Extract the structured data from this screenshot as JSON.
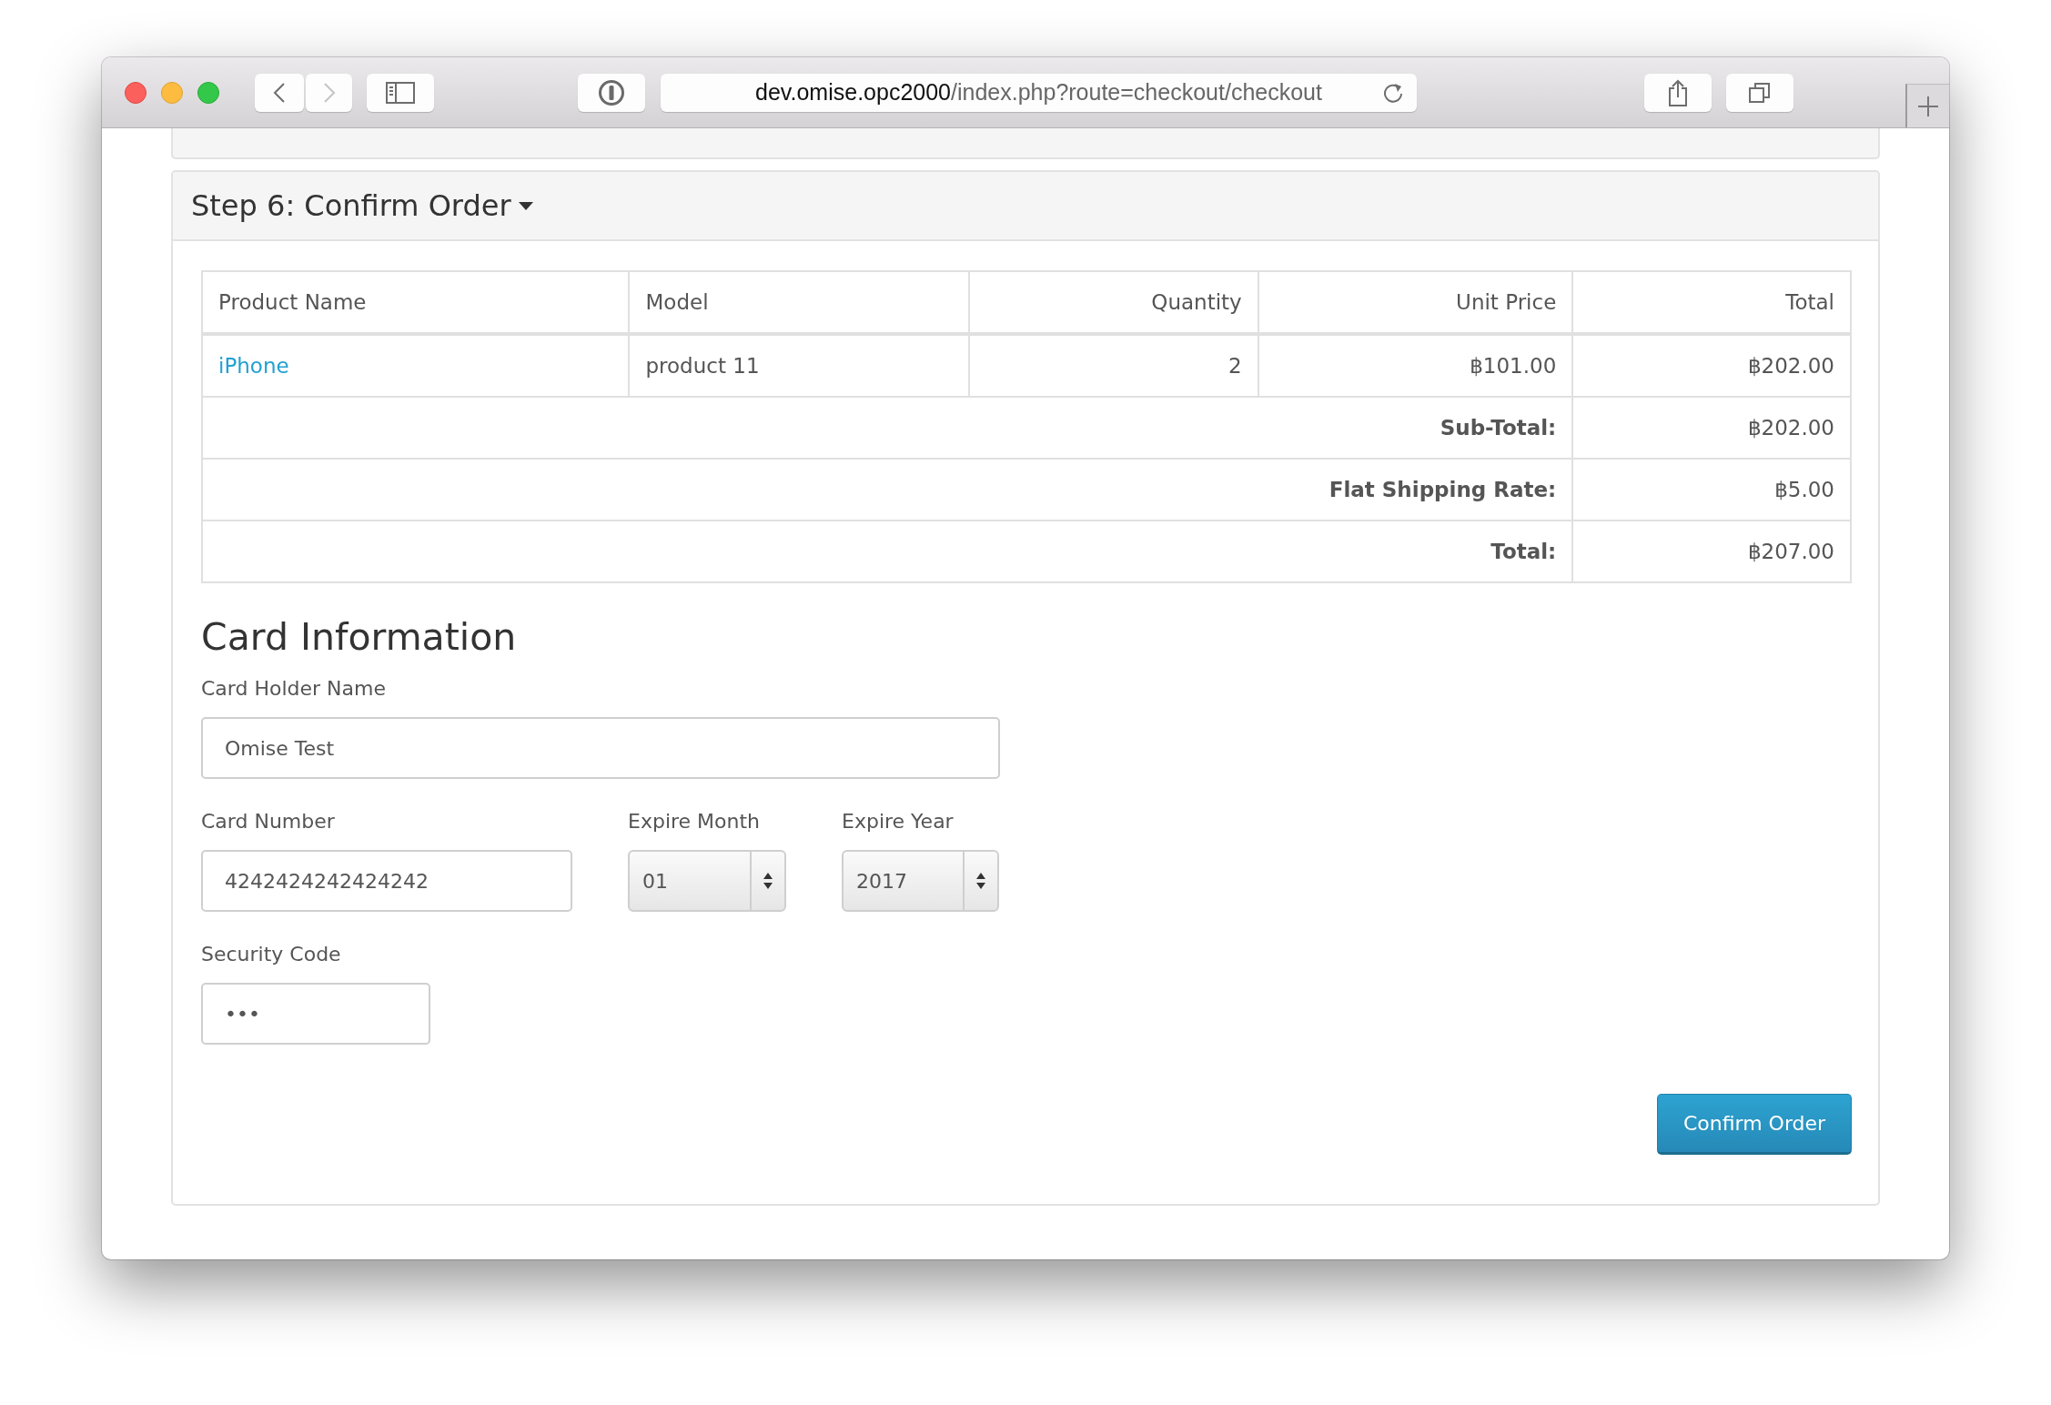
{
  "browser": {
    "url_host": "dev.omise.opc2000",
    "url_path": "/index.php?route=checkout/checkout"
  },
  "steps": [
    {
      "title": "Step 6: Confirm Order"
    }
  ],
  "order_table": {
    "columns": [
      "Product Name",
      "Model",
      "Quantity",
      "Unit Price",
      "Total"
    ],
    "rows": [
      {
        "product": "iPhone",
        "model": "product 11",
        "quantity": "2",
        "unit_price": "฿101.00",
        "total": "฿202.00"
      }
    ],
    "totals": [
      {
        "label": "Sub-Total:",
        "value": "฿202.00"
      },
      {
        "label": "Flat Shipping Rate:",
        "value": "฿5.00"
      },
      {
        "label": "Total:",
        "value": "฿207.00"
      }
    ]
  },
  "card_form": {
    "title": "Card Information",
    "fields": [
      {
        "kind": "text",
        "label": "Card Holder Name",
        "value": "Omise Test"
      },
      {
        "kind": "text",
        "label": "Card Number",
        "value": "4242424242424242"
      },
      {
        "kind": "select",
        "label": "Expire Month",
        "value": "01"
      },
      {
        "kind": "select",
        "label": "Expire Year",
        "value": "2017"
      },
      {
        "kind": "text",
        "label": "Security Code",
        "value": "•••"
      }
    ],
    "confirm_button": "Confirm Order"
  }
}
